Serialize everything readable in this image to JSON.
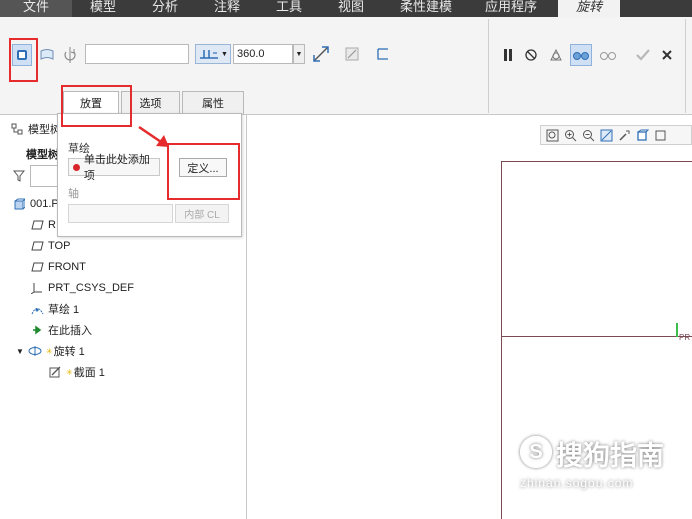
{
  "menubar": {
    "items": [
      {
        "label": "文件"
      },
      {
        "label": "模型"
      },
      {
        "label": "分析"
      },
      {
        "label": "注释"
      },
      {
        "label": "工具"
      },
      {
        "label": "视图"
      },
      {
        "label": "柔性建模"
      },
      {
        "label": "应用程序"
      },
      {
        "label": "旋转"
      }
    ],
    "active_index": 8
  },
  "ribbon": {
    "angle_value": "360.0"
  },
  "subtabs": [
    {
      "label": "放置"
    },
    {
      "label": "选项"
    },
    {
      "label": "属性"
    }
  ],
  "popup": {
    "sketch_label": "草绘",
    "sketch_collector": "单击此处添加项",
    "define_button": "定义...",
    "axis_label": "轴",
    "internal_cl_button": "内部 CL"
  },
  "left_panel": {
    "model_tree_title": "模型树",
    "model_tree_tab": "模型树",
    "tree": [
      {
        "label": "001.PRT"
      },
      {
        "label": "RIGHT"
      },
      {
        "label": "TOP"
      },
      {
        "label": "FRONT"
      },
      {
        "label": "PRT_CSYS_DEF"
      },
      {
        "label": "草绘 1"
      },
      {
        "label": "在此插入"
      },
      {
        "label": "旋转 1"
      },
      {
        "label": "截面 1"
      }
    ]
  },
  "graphics": {
    "csys_label": "PR"
  },
  "watermark": {
    "brand": "搜狗指南",
    "url": "zhinan.sogou.com"
  },
  "colors": {
    "highlight_red": "#e52b2b",
    "menubar_bg": "#3b3b3b",
    "sketch_line": "#7a4b55"
  }
}
